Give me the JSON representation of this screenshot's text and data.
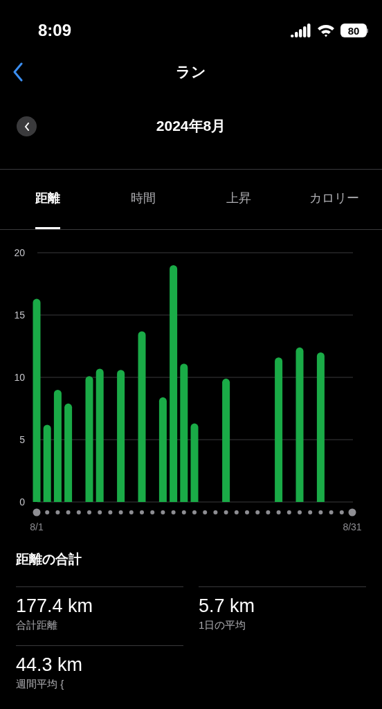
{
  "status_bar": {
    "time": "8:09",
    "battery": "80"
  },
  "nav": {
    "title": "ラン"
  },
  "period": {
    "label": "2024年8月"
  },
  "tabs": [
    {
      "label": "距離",
      "selected": true
    },
    {
      "label": "時間",
      "selected": false
    },
    {
      "label": "上昇",
      "selected": false
    },
    {
      "label": "カロリー",
      "selected": false
    }
  ],
  "chart_data": {
    "type": "bar",
    "categories": [
      "8/1",
      null,
      null,
      null,
      null,
      null,
      null,
      null,
      null,
      null,
      null,
      null,
      null,
      null,
      null,
      null,
      null,
      null,
      null,
      null,
      null,
      null,
      null,
      null,
      null,
      null,
      null,
      null,
      null,
      null,
      "8/31"
    ],
    "grid": true,
    "series": [
      {
        "color": "#1aab47",
        "values": [
          16.3,
          6.2,
          9.0,
          7.9,
          null,
          10.1,
          10.7,
          null,
          10.6,
          null,
          13.7,
          null,
          8.4,
          19.0,
          11.1,
          6.3,
          null,
          null,
          9.9,
          null,
          null,
          null,
          null,
          11.6,
          null,
          12.4,
          null,
          12.0,
          null,
          null,
          null
        ]
      }
    ],
    "ylim": [
      0,
      20
    ],
    "yticks": [
      0,
      5,
      10,
      15,
      20
    ]
  },
  "summary": {
    "title": "距離の合計",
    "stats": [
      {
        "value": "177.4 km",
        "label": "合計距離"
      },
      {
        "value": "5.7 km",
        "label": "1日の平均"
      },
      {
        "value": "44.3 km",
        "label": "週間平均 {"
      }
    ]
  }
}
